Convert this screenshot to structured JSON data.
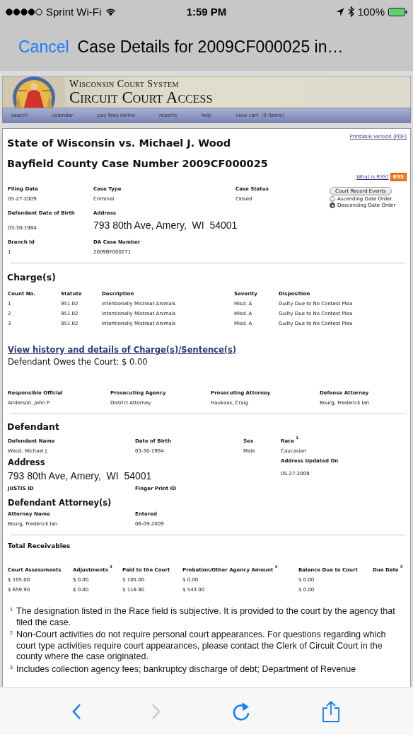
{
  "status_bar": {
    "carrier": "Sprint Wi-Fi",
    "time": "1:59 PM",
    "battery": "100%"
  },
  "nav": {
    "cancel": "Cancel",
    "title": "Case Details for 2009CF000025 in…"
  },
  "site": {
    "system": "Wisconsin Court System",
    "title": "Circuit Court Access",
    "menu": [
      "search",
      "calendar",
      "pay fees online",
      "reports",
      "help",
      "view cart  (0 items)"
    ]
  },
  "case": {
    "title": "State of Wisconsin vs. Michael J. Wood",
    "subtitle": "Bayfield County Case Number 2009CF000025",
    "printable": "Printable Version (PDF)",
    "rss_help": "What is RSS?",
    "rss": "RSS"
  },
  "summary_rows": [
    [
      {
        "label": "Filing Date",
        "value": "05-27-2009"
      },
      {
        "label": "Case Type",
        "value": "Criminal"
      },
      {
        "label": "Case Status",
        "value": "Closed"
      }
    ],
    [
      {
        "label": "Defendant Date of Birth",
        "value": "03-30-1984"
      },
      {
        "label": "Address",
        "value": "793 80th Ave, Amery,  WI  54001",
        "kind": "large"
      }
    ],
    [
      {
        "label": "Branch Id",
        "value": "1"
      },
      {
        "label": "DA Case Number",
        "value": "2009BY000271"
      }
    ]
  ],
  "events": {
    "button": "Court Record Events",
    "orders": [
      {
        "label": "Ascending Date Order",
        "selected": false
      },
      {
        "label": "Descending Date Order",
        "selected": true
      }
    ]
  },
  "charges": {
    "heading": "Charge(s)",
    "columns": [
      "Count No.",
      "Statute",
      "Description",
      "Severity",
      "Disposition"
    ],
    "rows": [
      [
        "1",
        "951.02",
        "Intentionally Mistreat Animals",
        "Misd. A",
        "Guilty Due to No Contest Plea"
      ],
      [
        "2",
        "951.02",
        "Intentionally Mistreat Animals",
        "Misd. A",
        "Guilty Due to No Contest Plea"
      ],
      [
        "3",
        "951.02",
        "Intentionally Mistreat Animals",
        "Misd. A",
        "Guilty Due to No Contest Plea"
      ]
    ]
  },
  "history_link": "View history and details of Charge(s)/Sentence(s)",
  "owes": "Defendant Owes the Court: $ 0.00",
  "officials": [
    {
      "label": "Responsible Official",
      "value": "Anderson, John P."
    },
    {
      "label": "Prosecuting Agency",
      "value": "District Attorney"
    },
    {
      "label": "Prosecuting Attorney",
      "value": "Haukaas, Craig"
    },
    {
      "label": "Defense Attorney",
      "value": "Bourg, Frederick Ian"
    }
  ],
  "defendant": {
    "heading": "Defendant",
    "fields": [
      {
        "label": "Defendant Name",
        "value": "Wood, Michael J."
      },
      {
        "label": "Date of Birth",
        "value": "03-30-1984"
      },
      {
        "label": "Sex",
        "value": "Male"
      },
      {
        "label": "Race $^{1}$",
        "value": "Caucasian"
      }
    ],
    "address_heading": "Address",
    "address": "793 80th Ave, Amery,  WI  54001",
    "updated_label": "Address Updated On",
    "updated_value": "05-27-2009",
    "id_labels": [
      "JUSTIS ID",
      "Finger Print ID"
    ],
    "attorneys_heading": "Defendant Attorney(s)",
    "attorney_columns": [
      "Attorney Name",
      "Entered"
    ],
    "attorneys": [
      [
        "Bourg, Frederick Ian",
        "06-09-2009"
      ]
    ]
  },
  "receivables": {
    "heading": "Total Receivables",
    "columns": [
      "Court Assessments",
      "Adjustments $^{3}$",
      "Paid to the Court",
      "Probation/Other Agency Amount $^{4}$",
      "Balance Due to Court",
      "Due Date $^{5}$"
    ],
    "rows": [
      [
        "$ 105.00",
        "$ 0.00",
        "$ 105.00",
        "$ 0.00",
        "$ 0.00"
      ],
      [
        "$ 659.90",
        "$ 0.00",
        "$ 116.90",
        "$ 543.00",
        "$ 0.00"
      ]
    ]
  },
  "footnotes": [
    {
      "mark": "1",
      "text": "The designation listed in the Race field is subjective. It is provided to the court by the agency that filed the case."
    },
    {
      "mark": "2",
      "text": "Non-Court activities do not require personal court appearances. For questions regarding which court type activities require court appearances, please contact the Clerk of Circuit Court in the county where the case originated."
    },
    {
      "mark": "3",
      "text": "Includes collection agency fees; bankruptcy discharge of debt; Department of Revenue"
    }
  ],
  "toolbar": [
    {
      "kind": "back",
      "disabled": false
    },
    {
      "kind": "forward",
      "disabled": true
    },
    {
      "kind": "reload",
      "disabled": false
    },
    {
      "kind": "share",
      "disabled": false
    }
  ]
}
